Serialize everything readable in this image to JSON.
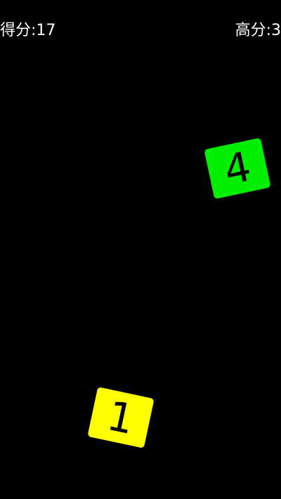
{
  "hud": {
    "score_label": "得分:17",
    "high_score_label": "高分:3",
    "score": 17
  },
  "tiles": [
    {
      "number": "4",
      "color": "#00ee00"
    },
    {
      "number": "1",
      "color": "#ffff00"
    }
  ],
  "colors": {
    "background": "#000000",
    "hud_text": "#ffffff"
  }
}
